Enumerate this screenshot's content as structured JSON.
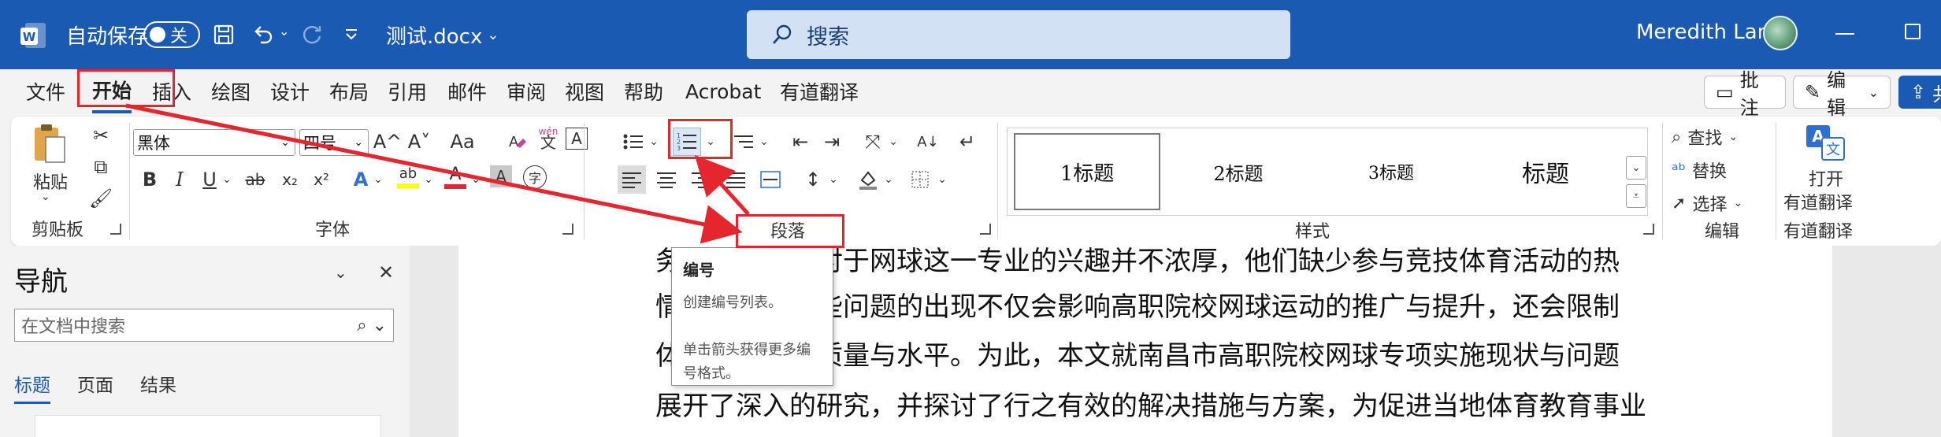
{
  "titlebar": {
    "autosave_label": "自动保存",
    "autosave_state": "关",
    "filename": "测试.docx",
    "search_placeholder": "搜索",
    "user_name": "Meredith Lan"
  },
  "menu": {
    "tabs": [
      "文件",
      "开始",
      "插入",
      "绘图",
      "设计",
      "布局",
      "引用",
      "邮件",
      "审阅",
      "视图",
      "帮助",
      "Acrobat",
      "有道翻译"
    ],
    "active_tab": "开始",
    "comments_label": "批注",
    "editing_label": "编辑",
    "share_label": "共"
  },
  "ribbon": {
    "clipboard": {
      "paste_label": "粘贴",
      "group_label": "剪贴板"
    },
    "font": {
      "font_name": "黑体",
      "font_size": "四号",
      "grow": "A^",
      "shrink": "A˅",
      "change_case": "Aa",
      "phonetic": "wén",
      "phonetic_char": "文",
      "char_border": "A",
      "bold": "B",
      "italic": "I",
      "underline": "U",
      "strike": "ab",
      "subscript": "x₂",
      "superscript": "x²",
      "effects": "A",
      "highlight": "ab",
      "font_color": "A",
      "shading": "A",
      "enclose": "字",
      "group_label": "字体"
    },
    "paragraph": {
      "group_label": "段落"
    },
    "styles": {
      "items": [
        "1标题",
        "2标题",
        "3标题",
        "标题"
      ],
      "group_label": "样式"
    },
    "editing": {
      "find": "查找",
      "replace": "替换",
      "select": "选择",
      "group_label": "编辑"
    },
    "youdao": {
      "open_line1": "打开",
      "open_line2": "有道翻译",
      "group_label": "有道翻译"
    }
  },
  "navigation": {
    "title": "导航",
    "search_placeholder": "在文档中搜索",
    "tabs": [
      "标题",
      "页面",
      "结果"
    ],
    "active_tab": "标题"
  },
  "document": {
    "lines": [
      "务　　　　　对于网球这一专业的兴趣并不浓厚，他们缺少参与竞技体育活动的热",
      "情　　　　　些问题的出现不仅会影响高职院校网球运动的推广与提升，还会限制",
      "体　　　　　质量与水平。为此，本文就南昌市高职院校网球专项实施现状与问题",
      "展开了深入的研究，并探讨了行之有效的解决措施与方案，为促进当地体育教育事业"
    ]
  },
  "tooltip": {
    "title": "编号",
    "description": "创建编号列表。",
    "extra": "单击箭头获得更多编号格式。"
  },
  "colors": {
    "brand": "#1b5ab3",
    "annotation": "#e5262f",
    "highlight_yellow": "#ffff00",
    "font_red": "#e5262f"
  }
}
